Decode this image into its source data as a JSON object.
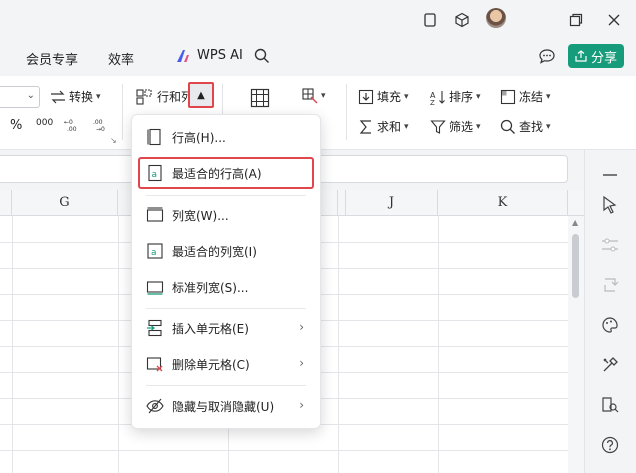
{
  "titlebar": {
    "icons": [
      "window-restore-icon",
      "cube-icon",
      "user-avatar",
      "maximize-icon",
      "close-icon"
    ]
  },
  "menubar": {
    "tabs": [
      {
        "label": "会员专享"
      },
      {
        "label": "效率"
      }
    ],
    "wps_ai": "WPS AI",
    "share": "分享"
  },
  "ribbon": {
    "convert": "转换",
    "row_col": "行和列",
    "fill": "填充",
    "sort": "排序",
    "freeze": "冻结",
    "sum": "求和",
    "filter": "筛选",
    "find": "查找",
    "percent": "%",
    "thousands": "000"
  },
  "grid": {
    "columns": [
      {
        "label": ""
      },
      {
        "label": "G"
      },
      {
        "label": ""
      },
      {
        "label": ""
      },
      {
        "label": ""
      },
      {
        "label": "J"
      },
      {
        "label": "K"
      }
    ]
  },
  "dropdown": {
    "items": [
      {
        "label": "行高(H)...",
        "icon": "row-height-icon",
        "submenu": false
      },
      {
        "label": "最适合的行高(A)",
        "icon": "autofit-row-height-icon",
        "submenu": false,
        "highlighted": true
      },
      {
        "label": "列宽(W)...",
        "icon": "column-width-icon",
        "submenu": false
      },
      {
        "label": "最适合的列宽(I)",
        "icon": "autofit-column-width-icon",
        "submenu": false
      },
      {
        "label": "标准列宽(S)...",
        "icon": "standard-column-width-icon",
        "submenu": false
      },
      {
        "label": "插入单元格(E)",
        "icon": "insert-cells-icon",
        "submenu": true
      },
      {
        "label": "删除单元格(C)",
        "icon": "delete-cells-icon",
        "submenu": true
      },
      {
        "label": "隐藏与取消隐藏(U)",
        "icon": "hide-unhide-icon",
        "submenu": true
      }
    ]
  },
  "colors": {
    "accent": "#169c7b",
    "highlight_border": "#e0474c"
  }
}
